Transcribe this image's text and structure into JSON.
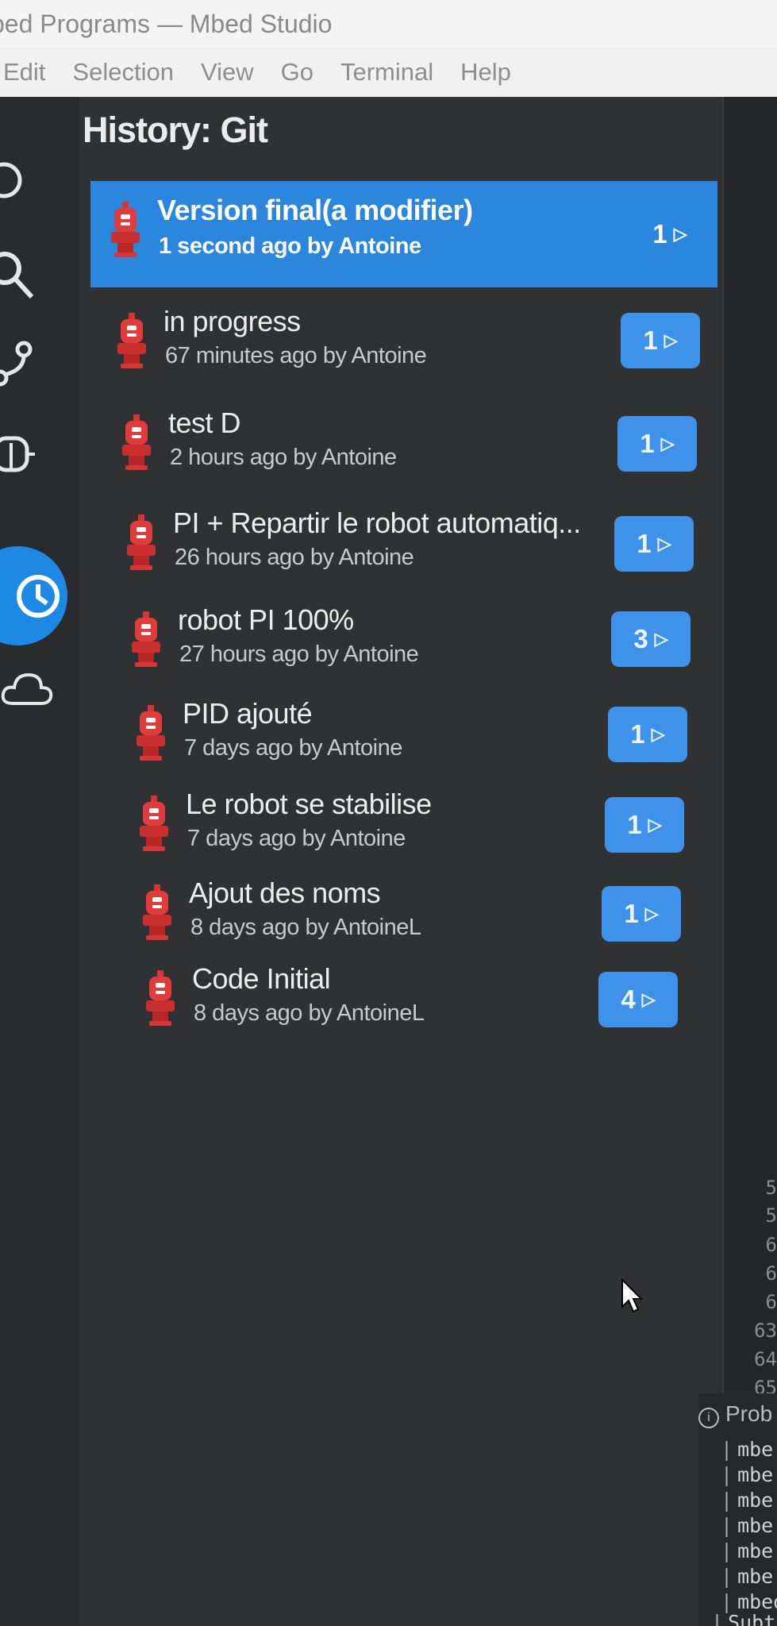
{
  "window": {
    "title": "bed Programs — Mbed Studio"
  },
  "menu": [
    "Edit",
    "Selection",
    "View",
    "Go",
    "Terminal",
    "Help"
  ],
  "activity_bar": [
    "source-control-icon",
    "search-icon",
    "git-branch-icon",
    "debug-icon",
    "history-icon",
    "cloud-icon"
  ],
  "history": {
    "title": "History: Git",
    "entries": [
      {
        "message": "Version final(a modifier)",
        "meta": "1 second ago by Antoine",
        "count": "1",
        "selected": true
      },
      {
        "message": "in progress",
        "meta": "67 minutes ago by Antoine",
        "count": "1"
      },
      {
        "message": "test D",
        "meta": "2 hours ago by Antoine",
        "count": "1"
      },
      {
        "message": "PI + Repartir le robot automatiq...",
        "meta": "26 hours ago by Antoine",
        "count": "1"
      },
      {
        "message": "robot PI 100%",
        "meta": "27 hours ago by Antoine",
        "count": "3"
      },
      {
        "message": "PID ajouté",
        "meta": "7 days ago by Antoine",
        "count": "1"
      },
      {
        "message": "Le robot se stabilise",
        "meta": "7 days ago by Antoine",
        "count": "1"
      },
      {
        "message": "Ajout des noms",
        "meta": "8 days ago by AntoineL",
        "count": "1"
      },
      {
        "message": "Code Initial",
        "meta": "8 days ago by AntoineL",
        "count": "4"
      }
    ]
  },
  "editor_gutter": {
    "line_numbers": [
      "5",
      "5",
      "6",
      "6",
      "6",
      "63",
      "64",
      "65"
    ]
  },
  "problems_panel": {
    "title": "Prob",
    "lines": [
      "mbe",
      "mbe",
      "mbe",
      "mbe",
      "mbe",
      "mbe",
      "mbed",
      "Subt"
    ]
  },
  "colors": {
    "accent": "#2b86dd",
    "badge": "#3f92ea",
    "panel": "#303133"
  }
}
